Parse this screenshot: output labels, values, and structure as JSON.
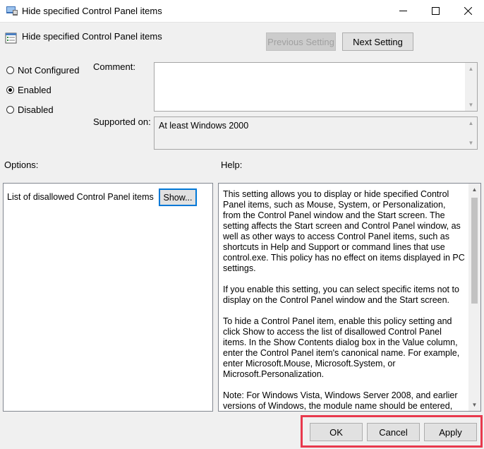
{
  "window": {
    "title": "Hide specified Control Panel items",
    "icon": "policy-settings-icon"
  },
  "header": {
    "title": "Hide specified Control Panel items",
    "icon": "policy-setting-icon"
  },
  "nav": {
    "previous_label": "Previous Setting",
    "next_label": "Next Setting"
  },
  "state": {
    "options": [
      {
        "label": "Not Configured",
        "checked": false
      },
      {
        "label": "Enabled",
        "checked": true
      },
      {
        "label": "Disabled",
        "checked": false
      }
    ]
  },
  "comment": {
    "label": "Comment:",
    "value": ""
  },
  "supported": {
    "label": "Supported on:",
    "value": "At least Windows 2000"
  },
  "options_section": {
    "label": "Options:",
    "item_label": "List of disallowed Control Panel items",
    "show_button": "Show..."
  },
  "help_section": {
    "label": "Help:",
    "paragraphs": [
      "This setting allows you to display or hide specified Control Panel items, such as Mouse, System, or Personalization, from the Control Panel window and the Start screen. The setting affects the Start screen and Control Panel window, as well as other ways to access Control Panel items, such as shortcuts in Help and Support or command lines that use control.exe. This policy has no effect on items displayed in PC settings.",
      "If you enable this setting, you can select specific items not to display on the Control Panel window and the Start screen.",
      "To hide a Control Panel item, enable this policy setting and click Show to access the list of disallowed Control Panel items. In the Show Contents dialog box in the Value column, enter the Control Panel item's canonical name. For example, enter Microsoft.Mouse, Microsoft.System, or Microsoft.Personalization.",
      "Note: For Windows Vista, Windows Server 2008, and earlier versions of Windows, the module name should be entered, for example timedate.cpl or inetcpl.cpl. If a Control Panel item does not have a CPL file, or the CPL file contains multiple applets, then"
    ]
  },
  "footer": {
    "ok_label": "OK",
    "cancel_label": "Cancel",
    "apply_label": "Apply"
  },
  "colors": {
    "highlight": "#e8394d",
    "focus_border": "#0078d7"
  }
}
